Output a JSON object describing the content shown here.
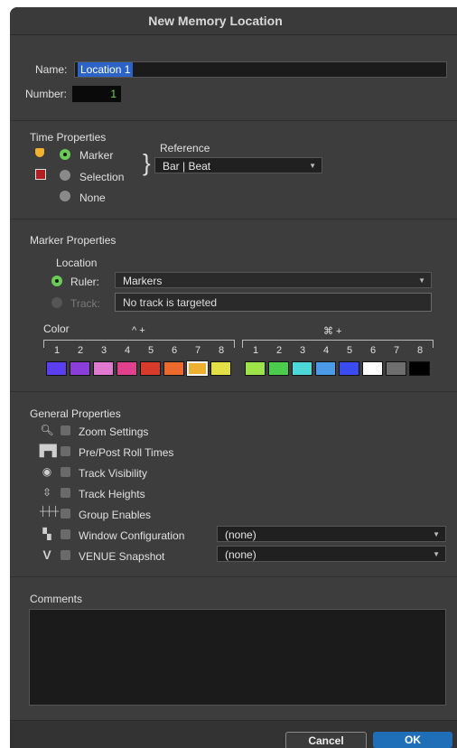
{
  "window": {
    "title": "New Memory Location"
  },
  "name_row": {
    "name_label": "Name:",
    "name_value": "Location 1",
    "number_label": "Number:",
    "number_value": "1"
  },
  "time_properties": {
    "heading": "Time Properties",
    "reference_label": "Reference",
    "reference_value": "Bar | Beat",
    "options": [
      "Marker",
      "Selection",
      "None"
    ],
    "selected": "Marker"
  },
  "marker_properties": {
    "heading": "Marker Properties",
    "location_label": "Location",
    "ruler_label": "Ruler:",
    "ruler_value": "Markers",
    "track_label": "Track:",
    "track_value": "No track is targeted",
    "color_label": "Color",
    "group1_modifier": "^ +",
    "group2_modifier": "⌘ +",
    "numbers": [
      "1",
      "2",
      "3",
      "4",
      "5",
      "6",
      "7",
      "8"
    ],
    "swatches_group1": [
      "#5b3ff0",
      "#8b3fd8",
      "#e07ad0",
      "#e0408c",
      "#d83a2c",
      "#ec6a2c",
      "#eeb030",
      "#e2e044"
    ],
    "swatches_group2": [
      "#9ee34a",
      "#4ccc4c",
      "#4cd8d8",
      "#4a9ae8",
      "#3a4cf0",
      "#ffffff",
      "#6e6e6e",
      "#000000"
    ],
    "selected_swatch": "group1-7"
  },
  "general_properties": {
    "heading": "General Properties",
    "items": [
      {
        "label": "Zoom Settings",
        "icon": "magnifier-icon"
      },
      {
        "label": "Pre/Post Roll Times",
        "icon": "preroll-icon"
      },
      {
        "label": "Track Visibility",
        "icon": "eye-icon"
      },
      {
        "label": "Track Heights",
        "icon": "track-heights-icon"
      },
      {
        "label": "Group Enables",
        "icon": "group-enables-icon"
      },
      {
        "label": "Window Configuration",
        "icon": "window-config-icon",
        "dropdown": "(none)"
      },
      {
        "label": "VENUE Snapshot",
        "icon": "venue-icon",
        "dropdown": "(none)"
      }
    ]
  },
  "comments": {
    "heading": "Comments",
    "value": ""
  },
  "buttons": {
    "cancel": "Cancel",
    "ok": "OK"
  },
  "colors": {
    "accent_blue": "#2b63c6",
    "ok_blue": "#1f6fb8",
    "radio_on": "#6bcb57"
  }
}
